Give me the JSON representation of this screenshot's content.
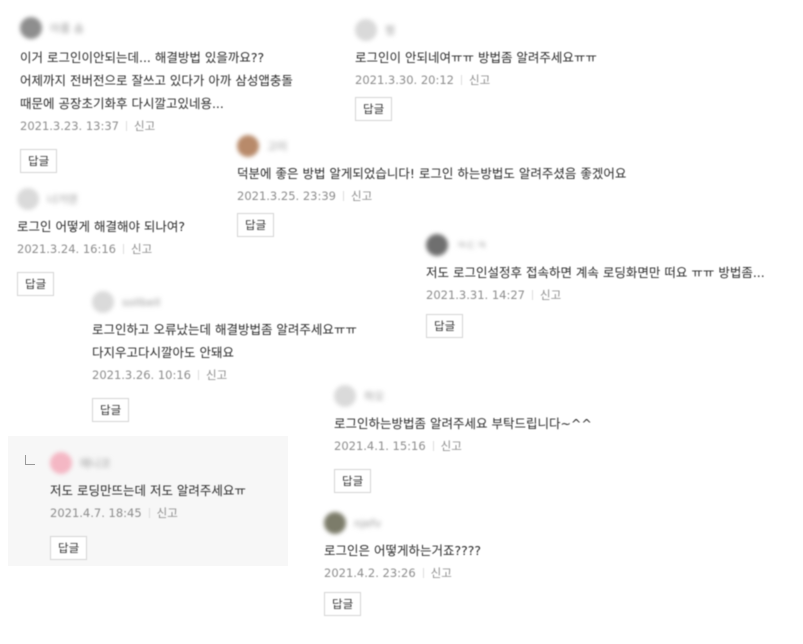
{
  "reply_button_label": "답글",
  "report_label": "신고",
  "comments": [
    {
      "nickname": "아롬 솜",
      "avatar_color": "#8e8e8e",
      "lines": [
        "이거 로그인이안되는데... 해결방법 있을까요??",
        "어제까지 전버전으로 잘쓰고 있다가 아까 삼성앱충돌",
        "때문에 공장초기화후 다시깔고있네용..."
      ],
      "date": "2021.3.23. 13:37"
    },
    {
      "nickname": "찡",
      "avatar_color": "#d9d9d9",
      "lines": [
        "로그인이 안되네여ㅠㅠ 방법좀 알려주세요ㅠㅠ"
      ],
      "date": "2021.3.30. 20:12"
    },
    {
      "nickname": "고미",
      "avatar_color": "#b88a6a",
      "lines": [
        "덕분에 좋은 방법 알게되었습니다! 로그인 하는방법도 알려주셨음 좋겠어요"
      ],
      "date": "2021.3.25. 23:39"
    },
    {
      "nickname": "너거덴",
      "avatar_color": "#dadada",
      "lines": [
        "로그인 어떻게 해결해야 되나여?"
      ],
      "date": "2021.3.24. 16:16"
    },
    {
      "nickname": "ㅋㄷㅋ",
      "avatar_color": "#6f6f6f",
      "lines": [
        "저도 로그인설정후 접속하면 계속 로딩화면만 떠요 ㅠㅠ 방법좀..."
      ],
      "date": "2021.3.31. 14:27"
    },
    {
      "nickname": "sollbell",
      "avatar_color": "#dadada",
      "lines": [
        "로그인하고 오류났는데 해결방법좀 알려주세요ㅠㅠ",
        "다지우고다시깔아도 안돼요"
      ],
      "date": "2021.3.26. 10:16"
    },
    {
      "nickname": "하오",
      "avatar_color": "#dadada",
      "lines": [
        "로그인하는방법좀 알려주세요 부탁드립니다~^^"
      ],
      "date": "2021.4.1. 15:16"
    },
    {
      "nickname": "애니코",
      "avatar_color": "#f4b7c4",
      "lines": [
        "저도 로딩만뜨는데 저도 알려주세요ㅠ"
      ],
      "date": "2021.4.7. 18:45"
    },
    {
      "nickname": "njefv",
      "avatar_color": "#7c7c6a",
      "lines": [
        "로그인은 어떻게하는거죠????"
      ],
      "date": "2021.4.2. 23:26"
    }
  ]
}
